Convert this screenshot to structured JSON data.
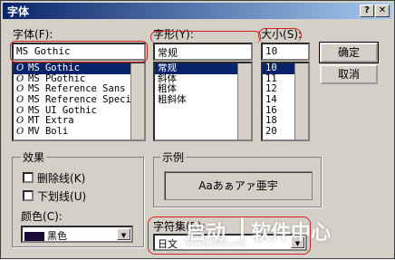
{
  "dialog": {
    "title": "字体",
    "help_glyph": "?",
    "close_glyph": "✕"
  },
  "font": {
    "label": "字体",
    "mnemonic": "(F):",
    "value": "MS Gothic",
    "items": [
      {
        "name": "MS Gothic",
        "icon": "opentype-icon",
        "selected": true
      },
      {
        "name": "MS PGothic",
        "icon": "opentype-icon",
        "selected": false
      },
      {
        "name": "MS Reference Sans",
        "icon": "opentype-icon",
        "selected": false
      },
      {
        "name": "MS Reference Speci",
        "icon": "opentype-icon",
        "selected": false
      },
      {
        "name": "MS UI Gothic",
        "icon": "opentype-icon",
        "selected": false
      },
      {
        "name": "MT Extra",
        "icon": "opentype-icon",
        "selected": false
      },
      {
        "name": "MV Boli",
        "icon": "opentype-icon",
        "selected": false
      }
    ]
  },
  "style": {
    "label": "字形",
    "mnemonic": "(Y):",
    "value": "常规",
    "items": [
      {
        "name": "常规",
        "selected": true
      },
      {
        "name": "斜体",
        "selected": false
      },
      {
        "name": "粗体",
        "selected": false
      },
      {
        "name": "粗斜体",
        "selected": false
      }
    ]
  },
  "size": {
    "label": "大小",
    "mnemonic": "(S):",
    "value": "10",
    "items": [
      {
        "name": "10",
        "selected": true
      },
      {
        "name": "11",
        "selected": false
      },
      {
        "name": "12",
        "selected": false
      },
      {
        "name": "14",
        "selected": false
      },
      {
        "name": "16",
        "selected": false
      },
      {
        "name": "18",
        "selected": false
      },
      {
        "name": "20",
        "selected": false
      }
    ]
  },
  "buttons": {
    "ok": "确定",
    "cancel": "取消"
  },
  "effects": {
    "title": "效果",
    "strikeout": "删除线",
    "strikeout_key": "(K)",
    "underline": "下划线",
    "underline_key": "(U)",
    "color_label": "颜色",
    "color_key": "(C):",
    "color_value": "黑色",
    "color_swatch": "#1a0a3a"
  },
  "sample": {
    "title": "示例",
    "text": "Aaあぁアァ亜宇"
  },
  "script": {
    "label": "字符集",
    "mnemonic": "(R):",
    "value": "日文"
  },
  "watermark": {
    "brand": "启动",
    "subtitle": "软件中心",
    "url": "www.QIDONG.COM"
  },
  "colors": {
    "highlight": "#0a246a",
    "annotation_red": "#d02020"
  }
}
